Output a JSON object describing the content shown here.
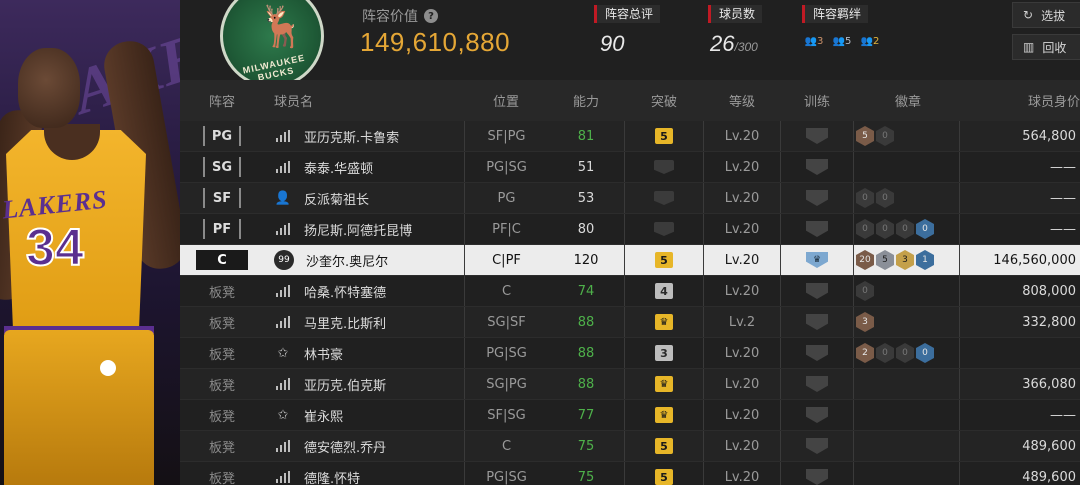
{
  "header": {
    "lineup_value_label": "阵容价值",
    "lineup_value": "149,610,880",
    "team_logo_text": "MILWAUKEE BUCKS",
    "stats": [
      {
        "label": "阵容总评",
        "value": "90"
      },
      {
        "label": "球员数",
        "value": "26",
        "max": "/300"
      },
      {
        "label": "阵容羁绊",
        "badges": [
          "3",
          "5",
          "2"
        ]
      }
    ],
    "buttons": {
      "select": "选拔",
      "recycle": "回收"
    }
  },
  "player_art": {
    "team_word": "LAKERS",
    "number": "34",
    "bg_word": "LAKERS"
  },
  "table": {
    "headers": [
      "阵容",
      "球员名",
      "位置",
      "能力",
      "突破",
      "等级",
      "训练",
      "徽章",
      "球员身价"
    ],
    "rows": [
      {
        "slot": "PG",
        "icon": "bars",
        "name": "亚历克斯.卡鲁索",
        "position": "SF|PG",
        "ability": "81",
        "ability_green": true,
        "breakthrough": "5",
        "brk_style": "gold",
        "level": "Lv.20",
        "training": "inactive",
        "badges": [
          {
            "v": "5",
            "c": "bronze"
          },
          {
            "v": "0",
            "c": "dim"
          }
        ],
        "value": "564,800"
      },
      {
        "slot": "SG",
        "icon": "bars",
        "name": "泰泰.华盛顿",
        "position": "PG|SG",
        "ability": "51",
        "ability_green": false,
        "breakthrough": "",
        "brk_style": "empty",
        "level": "Lv.20",
        "training": "inactive",
        "badges": [],
        "value": "——"
      },
      {
        "slot": "SF",
        "icon": "person",
        "name": "反派菊祖长",
        "position": "PG",
        "ability": "53",
        "ability_green": false,
        "breakthrough": "",
        "brk_style": "empty",
        "level": "Lv.20",
        "training": "inactive",
        "badges": [
          {
            "v": "0",
            "c": "dim"
          },
          {
            "v": "0",
            "c": "dim"
          }
        ],
        "value": "——"
      },
      {
        "slot": "PF",
        "icon": "bars",
        "name": "扬尼斯.阿德托昆博",
        "position": "PF|C",
        "ability": "80",
        "ability_green": false,
        "breakthrough": "",
        "brk_style": "empty",
        "level": "Lv.20",
        "training": "inactive",
        "badges": [
          {
            "v": "0",
            "c": "dim"
          },
          {
            "v": "0",
            "c": "dim"
          },
          {
            "v": "0",
            "c": "dim"
          },
          {
            "v": "0",
            "c": "blue"
          }
        ],
        "value": "——"
      },
      {
        "slot": "C",
        "icon": "99",
        "name": "沙奎尔.奥尼尔",
        "position": "C|PF",
        "ability": "120",
        "ability_green": false,
        "breakthrough": "5",
        "brk_style": "gold",
        "level": "Lv.20",
        "training": "active",
        "badges": [
          {
            "v": "20",
            "c": "bronze"
          },
          {
            "v": "5",
            "c": "silver"
          },
          {
            "v": "3",
            "c": "gold"
          },
          {
            "v": "1",
            "c": "blue"
          }
        ],
        "value": "146,560,000",
        "selected": true
      },
      {
        "slot": "板凳",
        "icon": "bars",
        "name": "哈桑.怀特塞德",
        "position": "C",
        "ability": "74",
        "ability_green": true,
        "breakthrough": "4",
        "brk_style": "silver",
        "level": "Lv.20",
        "training": "inactive",
        "badges": [
          {
            "v": "0",
            "c": "dim"
          }
        ],
        "value": "808,000"
      },
      {
        "slot": "板凳",
        "icon": "bars",
        "name": "马里克.比斯利",
        "position": "SG|SF",
        "ability": "88",
        "ability_green": true,
        "breakthrough": "♛",
        "brk_style": "crown",
        "level": "Lv.2",
        "training": "inactive",
        "badges": [
          {
            "v": "3",
            "c": "bronze"
          }
        ],
        "value": "332,800"
      },
      {
        "slot": "板凳",
        "icon": "star",
        "name": "林书豪",
        "position": "PG|SG",
        "ability": "88",
        "ability_green": true,
        "breakthrough": "3",
        "brk_style": "silver",
        "level": "Lv.20",
        "training": "inactive",
        "badges": [
          {
            "v": "2",
            "c": "bronze"
          },
          {
            "v": "0",
            "c": "dim"
          },
          {
            "v": "0",
            "c": "dim"
          },
          {
            "v": "0",
            "c": "blue"
          }
        ],
        "value": ""
      },
      {
        "slot": "板凳",
        "icon": "bars",
        "name": "亚历克.伯克斯",
        "position": "SG|PG",
        "ability": "88",
        "ability_green": true,
        "breakthrough": "♛",
        "brk_style": "crown",
        "level": "Lv.20",
        "training": "inactive",
        "badges": [],
        "value": "366,080"
      },
      {
        "slot": "板凳",
        "icon": "star",
        "name": "崔永熙",
        "position": "SF|SG",
        "ability": "77",
        "ability_green": true,
        "breakthrough": "♛",
        "brk_style": "crown",
        "level": "Lv.20",
        "training": "inactive",
        "badges": [],
        "value": "——"
      },
      {
        "slot": "板凳",
        "icon": "bars",
        "name": "德安德烈.乔丹",
        "position": "C",
        "ability": "75",
        "ability_green": true,
        "breakthrough": "5",
        "brk_style": "gold",
        "level": "Lv.20",
        "training": "inactive",
        "badges": [],
        "value": "489,600"
      },
      {
        "slot": "板凳",
        "icon": "bars",
        "name": "德隆.怀特",
        "position": "PG|SG",
        "ability": "75",
        "ability_green": true,
        "breakthrough": "5",
        "brk_style": "gold",
        "level": "Lv.20",
        "training": "inactive",
        "badges": [],
        "value": "489,600"
      }
    ]
  }
}
